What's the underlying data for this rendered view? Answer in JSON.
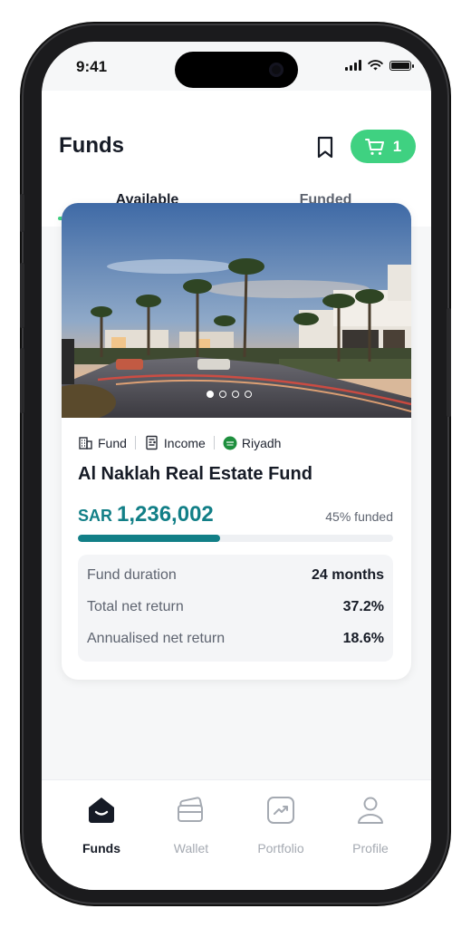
{
  "status_bar": {
    "time": "9:41"
  },
  "header": {
    "title": "Funds",
    "bookmark_icon": "bookmark-icon",
    "cart": {
      "icon": "cart-icon",
      "count": "1"
    },
    "accent_color": "#3fd181"
  },
  "tabs": [
    {
      "label": "Available",
      "active": true
    },
    {
      "label": "Funded",
      "active": false
    }
  ],
  "fund_card": {
    "image_pages": 4,
    "image_active_page": 1,
    "tags": [
      {
        "icon": "building-icon",
        "label": "Fund"
      },
      {
        "icon": "income-icon",
        "label": "Income"
      },
      {
        "icon": "saudi-flag-icon",
        "label": "Riyadh"
      }
    ],
    "name": "Al Naklah Real Estate Fund",
    "currency": "SAR",
    "amount": "1,236,002",
    "funded_label": "45% funded",
    "funded_fraction": 0.45,
    "brand_color": "#127f87",
    "stats": [
      {
        "label": "Fund duration",
        "value": "24 months"
      },
      {
        "label": "Total net return",
        "value": "37.2%"
      },
      {
        "label": "Annualised net return",
        "value": "18.6%"
      }
    ]
  },
  "bottom_nav": [
    {
      "label": "Funds",
      "icon": "funds-icon",
      "active": true
    },
    {
      "label": "Wallet",
      "icon": "wallet-icon",
      "active": false
    },
    {
      "label": "Portfolio",
      "icon": "portfolio-icon",
      "active": false
    },
    {
      "label": "Profile",
      "icon": "profile-icon",
      "active": false
    }
  ]
}
